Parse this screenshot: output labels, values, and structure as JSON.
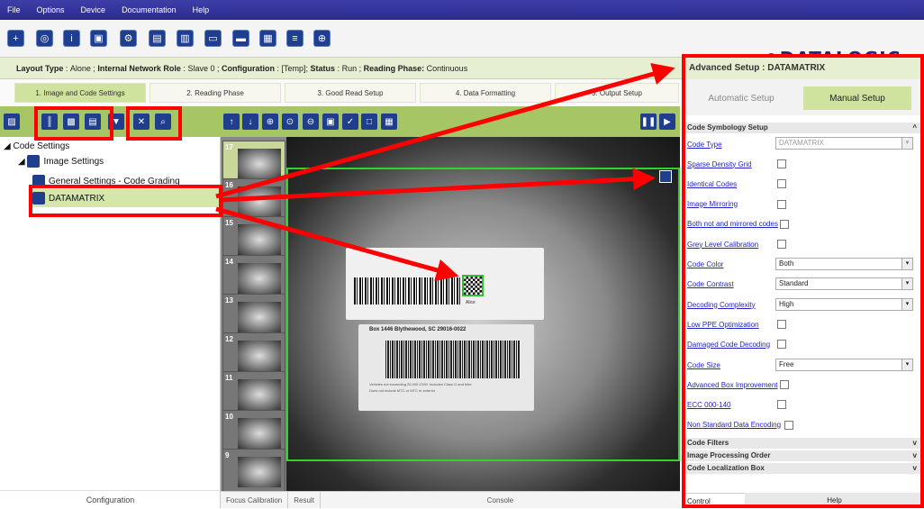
{
  "menu": [
    "File",
    "Options",
    "Device",
    "Documentation",
    "Help"
  ],
  "brand": "⊖DATALOGIC",
  "layout": {
    "label1": "Layout Type",
    "value1": "Alone",
    "label2": "Internal Network Role",
    "value2": "Slave 0",
    "label3": "Configuration",
    "value3": "[Temp];",
    "label4": "Status",
    "value4": "Run",
    "label5": "Reading Phase:",
    "value5": "Continuous"
  },
  "steps": [
    "1. Image and Code Settings",
    "2. Reading Phase",
    "3. Good Read Setup",
    "4. Data Formatting",
    "5. Output Setup"
  ],
  "tree": {
    "root": "Code Settings",
    "image": "Image Settings",
    "general": "General Settings - Code Grading",
    "datamatrix": "DATAMATRIX"
  },
  "left_bottom": "Configuration",
  "thumb_numbers": [
    "17",
    "16",
    "15",
    "14",
    "13",
    "12",
    "11",
    "10",
    "9"
  ],
  "image_text": {
    "label_box": "Box 1446 Blythewood, SC 29016-0022",
    "small1": "Vehicles not exceeding 26,000 GVW. Includes Class G and trike",
    "small2": "Does not include MTC or MTC er exterior",
    "dm_text": "Alice"
  },
  "bottom_tabs": [
    "Focus Calibration",
    "Result",
    "Console"
  ],
  "right": {
    "title": "Advanced Setup : DATAMATRIX",
    "auto": "Automatic Setup",
    "manual": "Manual Setup",
    "section1": "Code Symbology Setup",
    "rows": [
      {
        "label": "Code Type",
        "value": "DATAMATRIX"
      },
      {
        "label": "Sparse Density Grid"
      },
      {
        "label": "Identical Codes"
      },
      {
        "label": "Image Mirroring"
      },
      {
        "label": "Both not and mirrored codes"
      },
      {
        "label": "Grey Level Calibration"
      },
      {
        "label": "Code Color",
        "value": "Both"
      },
      {
        "label": "Code Contrast",
        "value": "Standard"
      },
      {
        "label": "Decoding Complexity",
        "value": "High"
      },
      {
        "label": "Low PPE Optimization"
      },
      {
        "label": "Damaged Code Decoding"
      },
      {
        "label": "Code Size",
        "value": "Free"
      },
      {
        "label": "Advanced Box Improvement"
      },
      {
        "label": "ECC 000-140"
      },
      {
        "label": "Non Standard Data Encoding"
      }
    ],
    "section2": "Code Filters",
    "section3": "Image Processing Order",
    "section4": "Code Localization Box",
    "tab_control": "Control",
    "tab_help": "Help"
  },
  "colors": {
    "menubar": "#2a2a8e",
    "accent_green": "#a6c564",
    "highlight": "#cfe29e",
    "annotation_red": "#ff0000",
    "roi_green": "#33d22c"
  }
}
